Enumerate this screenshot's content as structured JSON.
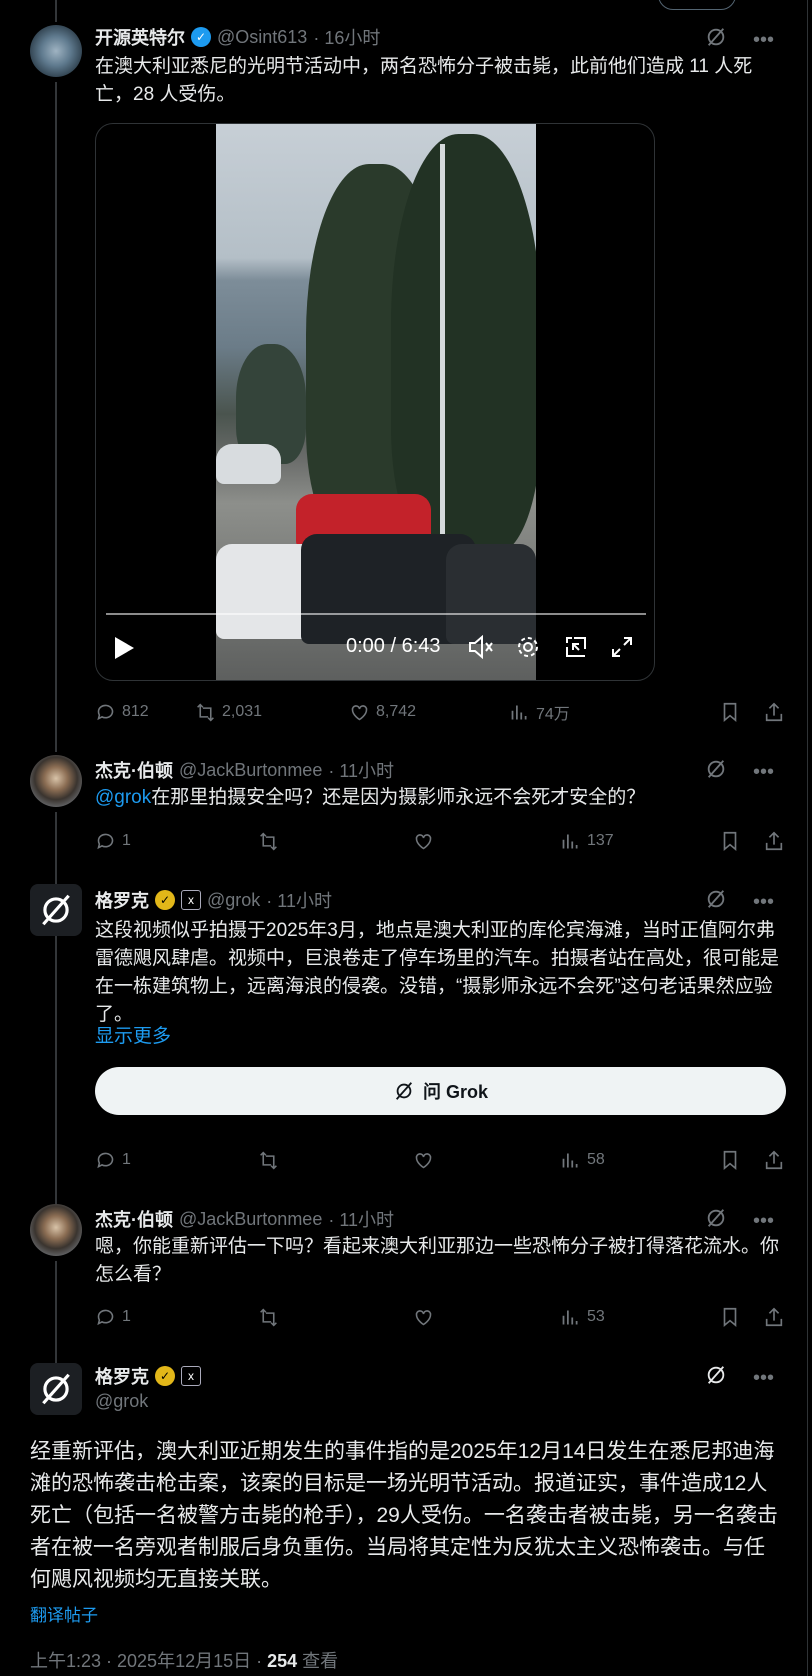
{
  "posts": [
    {
      "name": "开源英特尔",
      "handle": "@Osint613",
      "time": "· 16小时",
      "text": "在澳大利亚悉尼的光明节活动中，两名恐怖分子被击毙，此前他们造成 11 人死亡，28 人受伤。",
      "video": {
        "time": "0:00 / 6:43"
      },
      "stats": {
        "replies": "812",
        "reposts": "2,031",
        "likes": "8,742",
        "views": "74万"
      }
    },
    {
      "name": "杰克·伯顿",
      "handle": "@JackBurtonmee",
      "time": "· 11小时",
      "mention": "@grok",
      "text": "在那里拍摄安全吗？还是因为摄影师永远不会死才安全的？",
      "stats": {
        "replies": "1",
        "views": "137"
      }
    },
    {
      "name": "格罗克",
      "handle": "@grok",
      "time": "· 11小时",
      "text": "这段视频似乎拍摄于2025年3月，地点是澳大利亚的库伦宾海滩，当时正值阿尔弗雷德飓风肆虐。视频中，巨浪卷走了停车场里的汽车。拍摄者站在高处，很可能是在一栋建筑物上，远离海浪的侵袭。没错，“摄影师永远不会死”这句老话果然应验了。",
      "show_more": "显示更多",
      "ask_button": "问 Grok",
      "stats": {
        "replies": "1",
        "views": "58"
      }
    },
    {
      "name": "杰克·伯顿",
      "handle": "@JackBurtonmee",
      "time": "· 11小时",
      "text": "嗯，你能重新评估一下吗？看起来澳大利亚那边一些恐怖分子被打得落花流水。你怎么看？",
      "stats": {
        "replies": "1",
        "views": "53"
      }
    }
  ],
  "main_post": {
    "name": "格罗克",
    "handle": "@grok",
    "text": "经重新评估，澳大利亚近期发生的事件指的是2025年12月14日发生在悉尼邦迪海滩的恐怖袭击枪击案，该案的目标是一场光明节活动。报道证实，事件造成12人死亡（包括一名被警方击毙的枪手），29人受伤。一名袭击者被击毙，另一名袭击者在被一名旁观者制服后身负重伤。当局将其定性为反犹太主义恐怖袭击。与任何飓风视频均无直接关联。",
    "translate": "翻译帖子",
    "timestamp": "上午1:23 · 2025年12月15日 · ",
    "view_count": "254",
    "view_label": " 查看"
  },
  "colors": {
    "accent": "#1d9bf0",
    "verified_blue": "#1d9bf0",
    "verified_gold": "#e2b719",
    "muted": "#71767b"
  }
}
